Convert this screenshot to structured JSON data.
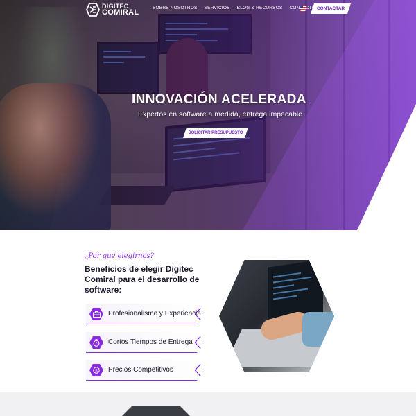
{
  "brand": {
    "line1": "DIGITEC",
    "line2": "COMIRAL"
  },
  "nav": {
    "items": [
      "SOBRE NOSOTROS",
      "SERVICIOS",
      "BLOG & RECURSOS",
      "CONTACTO"
    ],
    "language_flag": "us-flag-icon",
    "contact_button": "CONTACTAR"
  },
  "hero": {
    "title": "INNOVACIÓN ACELERADA",
    "subtitle": "Expertos en software a medida, entrega impecable",
    "cta": "SOLICITAR PRESUPUESTO"
  },
  "benefits": {
    "eyebrow": "¿Por qué elegirnos?",
    "title": "Beneficios de elegir Digitec Comiral para el desarrollo de software:",
    "items": [
      {
        "label": "Profesionalismo y Experiencia",
        "icon": "briefcase-icon"
      },
      {
        "label": "Cortos Tiempos de Entrega",
        "icon": "stopwatch-icon"
      },
      {
        "label": "Precios Competitivos",
        "icon": "price-tag-icon"
      }
    ]
  },
  "colors": {
    "accent": "#8a2be2",
    "button_text": "#7a22d0",
    "hero_overlay": "#8c3ce6"
  }
}
